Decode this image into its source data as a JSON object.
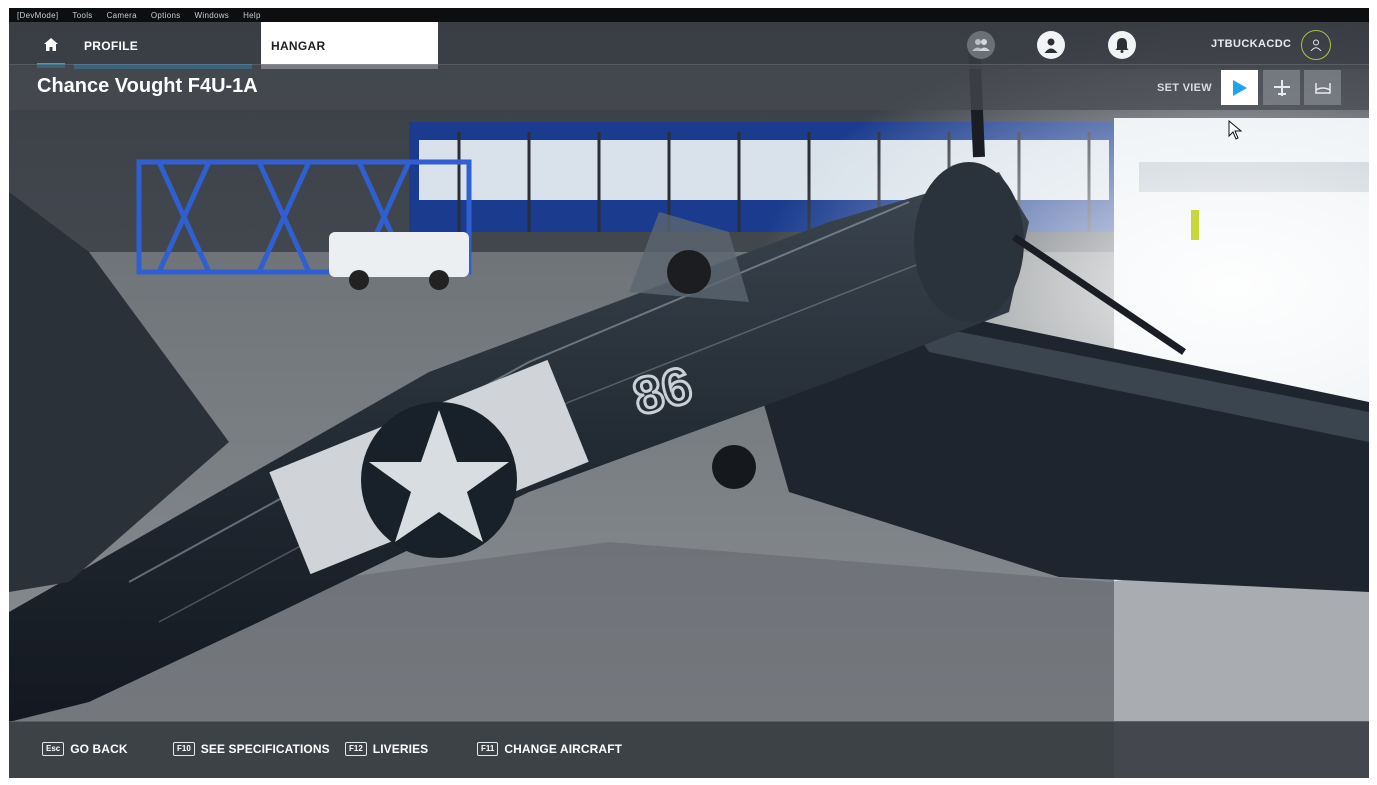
{
  "devmenu": {
    "items": [
      "[DevMode]",
      "Tools",
      "Camera",
      "Options",
      "Windows",
      "Help"
    ]
  },
  "nav": {
    "home_icon": "home-icon",
    "tabs": [
      {
        "label": "PROFILE",
        "active_underline": true
      },
      {
        "label": "HANGAR",
        "selected": true
      }
    ],
    "username": "JTBUCKACDC",
    "icons": [
      "friends-icon",
      "profile-icon",
      "notifications-icon",
      "avatar-icon"
    ]
  },
  "titlebar": {
    "title": "Chance Vought F4U-1A",
    "set_view_label": "SET VIEW",
    "view_buttons": [
      "play-icon",
      "plane-icon",
      "seat-icon"
    ]
  },
  "bottombar": {
    "actions": [
      {
        "key": "Esc",
        "label": "GO BACK"
      },
      {
        "key": "F10",
        "label": "SEE SPECIFICATIONS"
      },
      {
        "key": "F12",
        "label": "LIVERIES"
      },
      {
        "key": "F11",
        "label": "CHANGE AIRCRAFT"
      }
    ]
  },
  "scene": {
    "aircraft_number": "86"
  },
  "colors": {
    "accent": "#1fa6e6",
    "avatar_ring": "#a9c23f",
    "tab_selected_bg": "#ffffff"
  }
}
